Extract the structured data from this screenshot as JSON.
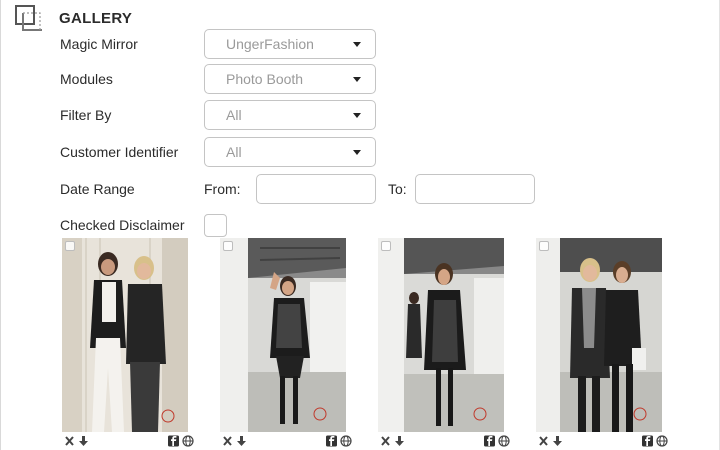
{
  "header": {
    "title": "GALLERY",
    "icon": "gallery-icon"
  },
  "filters": {
    "magic_mirror": {
      "label": "Magic Mirror",
      "value": "UngerFashion"
    },
    "modules": {
      "label": "Modules",
      "value": "Photo Booth"
    },
    "filter_by": {
      "label": "Filter By",
      "value": "All"
    },
    "customer_identifier": {
      "label": "Customer Identifier",
      "value": "All"
    },
    "date_range": {
      "label": "Date Range",
      "from_label": "From:",
      "to_label": "To:",
      "from_value": "",
      "to_value": ""
    },
    "checked_disclaimer": {
      "label": "Checked Disclaimer",
      "checked": false
    }
  },
  "photos": [
    {
      "id": "photo-1",
      "description": "two women posing",
      "actions": [
        "delete-icon",
        "download-icon",
        "facebook-icon",
        "globe-icon"
      ]
    },
    {
      "id": "photo-2",
      "description": "woman waving in store",
      "actions": [
        "delete-icon",
        "download-icon",
        "facebook-icon",
        "globe-icon"
      ]
    },
    {
      "id": "photo-3",
      "description": "woman in black coat in store",
      "actions": [
        "delete-icon",
        "download-icon",
        "facebook-icon",
        "globe-icon"
      ]
    },
    {
      "id": "photo-4",
      "description": "two women with scarves",
      "actions": [
        "delete-icon",
        "download-icon",
        "facebook-icon",
        "globe-icon"
      ]
    }
  ],
  "colors": {
    "border": "#c4c4c4",
    "text": "#2b2b2b",
    "placeholder": "#9a9a9a",
    "icon": "#444444"
  }
}
